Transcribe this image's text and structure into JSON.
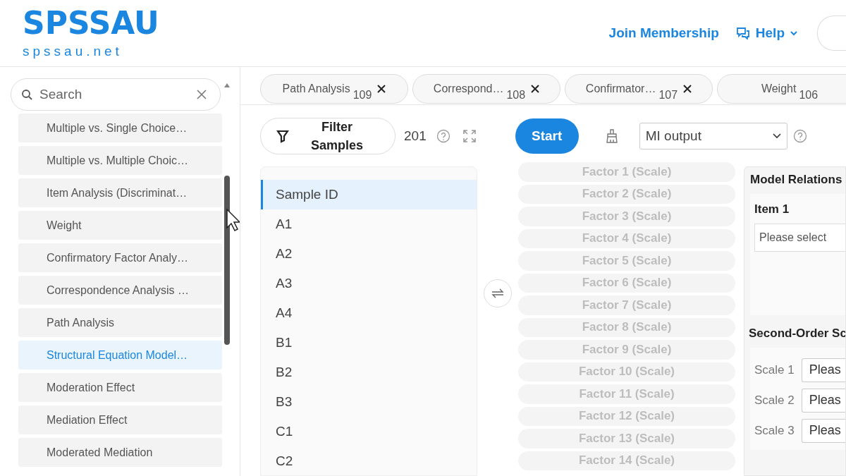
{
  "header": {
    "logo": "SPSSAU",
    "logo_subtitle": "spssau.net",
    "links": [
      {
        "label": "Join Membership",
        "kind": "link"
      },
      {
        "label": "Help",
        "kind": "menu"
      }
    ]
  },
  "sidebar": {
    "search": {
      "placeholder": "Search"
    },
    "items": [
      {
        "label": "Multiple vs. Single Choice…",
        "selected": false
      },
      {
        "label": "Multiple vs. Multiple Choic…",
        "selected": false
      },
      {
        "label": "Item Analysis (Discriminat…",
        "selected": false
      },
      {
        "label": "Weight",
        "selected": false
      },
      {
        "label": "Confirmatory Factor Analy…",
        "selected": false
      },
      {
        "label": "Correspondence Analysis …",
        "selected": false
      },
      {
        "label": "Path Analysis",
        "selected": false
      },
      {
        "label": "Structural Equation Model…",
        "selected": true
      },
      {
        "label": "Moderation Effect",
        "selected": false
      },
      {
        "label": "Mediation Effect",
        "selected": false
      },
      {
        "label": "Moderated Mediation",
        "selected": false
      }
    ]
  },
  "tabs": [
    {
      "label": "Path Analysis",
      "count": "109",
      "closable": true
    },
    {
      "label": "Correspond…",
      "count": "108",
      "closable": true
    },
    {
      "label": "Confirmator…",
      "count": "107",
      "closable": true
    },
    {
      "label": "Weight",
      "count": "106",
      "closable": false
    }
  ],
  "toolbar": {
    "filter_button": "Filter Samples",
    "sample_count": "201",
    "start_button": "Start",
    "output_select": "MI output"
  },
  "variables": [
    {
      "label": "Sample ID",
      "selected": true
    },
    {
      "label": "A1",
      "selected": false
    },
    {
      "label": "A2",
      "selected": false
    },
    {
      "label": "A3",
      "selected": false
    },
    {
      "label": "A4",
      "selected": false
    },
    {
      "label": "B1",
      "selected": false
    },
    {
      "label": "B2",
      "selected": false
    },
    {
      "label": "B3",
      "selected": false
    },
    {
      "label": "C1",
      "selected": false
    },
    {
      "label": "C2",
      "selected": false
    }
  ],
  "factors": [
    {
      "label": "Factor 1 (Scale)",
      "disabled": true
    },
    {
      "label": "Factor 2 (Scale)",
      "disabled": true
    },
    {
      "label": "Factor 3 (Scale)",
      "disabled": true
    },
    {
      "label": "Factor 4 (Scale)",
      "disabled": true
    },
    {
      "label": "Factor 5 (Scale)",
      "disabled": true
    },
    {
      "label": "Factor 6 (Scale)",
      "disabled": true
    },
    {
      "label": "Factor 7 (Scale)",
      "disabled": true
    },
    {
      "label": "Factor 8 (Scale)",
      "disabled": true
    },
    {
      "label": "Factor 9 (Scale)",
      "disabled": true
    },
    {
      "label": "Factor 10 (Scale)",
      "disabled": true
    },
    {
      "label": "Factor 11 (Scale)",
      "disabled": true
    },
    {
      "label": "Factor 12 (Scale)",
      "disabled": true
    },
    {
      "label": "Factor 13 (Scale)",
      "disabled": true
    },
    {
      "label": "Factor 14 (Scale)",
      "disabled": true
    }
  ],
  "model_panel": {
    "title": "Model Relations",
    "item_label": "Item 1",
    "item_placeholder": "Please select",
    "second_title": "Second-Order Sc",
    "scales": [
      {
        "label": "Scale 1",
        "placeholder": "Pleas"
      },
      {
        "label": "Scale 2",
        "placeholder": "Pleas"
      },
      {
        "label": "Scale 3",
        "placeholder": "Pleas"
      }
    ]
  }
}
